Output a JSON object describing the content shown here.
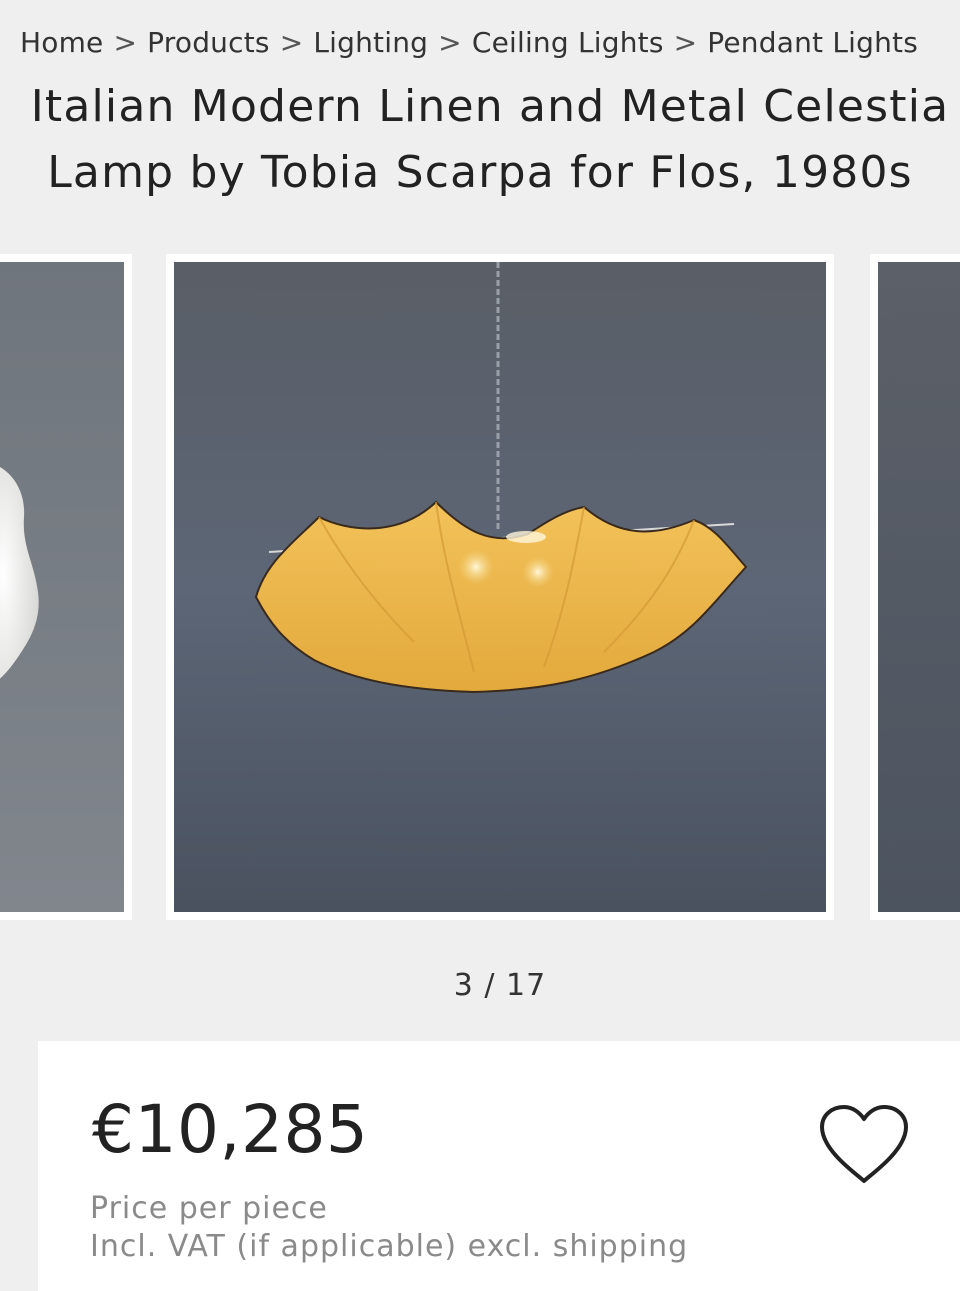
{
  "breadcrumb": {
    "items": [
      "Home",
      "Products",
      "Lighting",
      "Ceiling Lights",
      "Pendant Lights"
    ],
    "separator": ">"
  },
  "title": {
    "line1": "Italian Modern Linen and Metal Celestia",
    "line2": "Lamp by Tobia Scarpa for Flos, 1980s"
  },
  "gallery": {
    "counter": "3 / 17",
    "current_index": 3,
    "total": 17
  },
  "price": {
    "amount": "€10,285",
    "unit_note": "Price per piece",
    "tax_note": "Incl. VAT (if applicable) excl. shipping"
  },
  "icons": {
    "favorite": "heart-icon"
  },
  "colors": {
    "page_background": "#efefef",
    "card_background": "#ffffff",
    "photo_backdrop": "#5a6270",
    "lamp_shade": "#e8b64a"
  }
}
